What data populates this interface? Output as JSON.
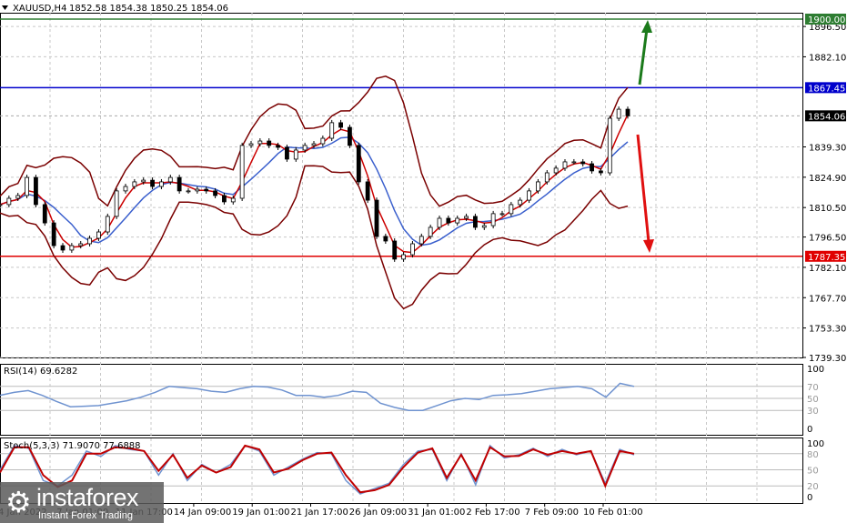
{
  "header": {
    "symbol": "XAUUSD,H4",
    "ohlc": "1852.58 1854.38 1850.25 1854.06"
  },
  "colors": {
    "resistance": "#2e7d32",
    "level_blue": "#0000cc",
    "support": "#e00000",
    "current": "#000000",
    "ma_fast": "#cc0000",
    "ma_slow": "#3a5fcd",
    "bands": "#7a0000",
    "rsi": "#6f93d0",
    "stoch_k": "#6f93d0",
    "stoch_d": "#c00000"
  },
  "levels": [
    {
      "label": "1900.00",
      "value": 1900.0,
      "color": "#2e7d32"
    },
    {
      "label": "1867.45",
      "value": 1867.45,
      "color": "#0000cc"
    },
    {
      "label": "1854.06",
      "value": 1854.06,
      "color": "#000000"
    },
    {
      "label": "1787.35",
      "value": 1787.35,
      "color": "#e00000"
    }
  ],
  "price_ticks": [
    "1896.50",
    "1882.10",
    "1839.30",
    "1824.90",
    "1810.50",
    "1796.50",
    "1782.10",
    "1767.70",
    "1753.30",
    "1739.30"
  ],
  "time_ticks": [
    "4 Jan 2022",
    "7 Jan 01:00",
    "11 Jan 17:00",
    "14 Jan 09:00",
    "19 Jan 01:00",
    "21 Jan 17:00",
    "26 Jan 09:00",
    "31 Jan 01:00",
    "2 Feb 17:00",
    "7 Feb 09:00",
    "10 Feb 01:00"
  ],
  "rsi": {
    "label": "RSI(14) 69.6282",
    "ticks": [
      "100",
      "70",
      "50",
      "30",
      "0"
    ]
  },
  "stoch": {
    "label": "Stoch(5,3,3) 71.9070 77.6888",
    "ticks": [
      "100",
      "80",
      "50",
      "20",
      "0"
    ]
  },
  "logo": {
    "name": "instaforex",
    "tagline": "Instant Forex Trading"
  },
  "chart_data": [
    {
      "type": "line",
      "title": "XAUUSD,H4",
      "ylim": [
        1739.3,
        1900.0
      ],
      "grid": true,
      "closes": [
        1811.9,
        1814.9,
        1816.2,
        1824.8,
        1811.9,
        1803.2,
        1792.4,
        1790.3,
        1792.4,
        1793.3,
        1795.9,
        1798.9,
        1806.3,
        1818.4,
        1820.5,
        1822.7,
        1823.5,
        1820.5,
        1822.7,
        1824.8,
        1818.4,
        1818.4,
        1819.2,
        1818.4,
        1816.2,
        1813.2,
        1814.9,
        1840.0,
        1840.8,
        1842.1,
        1840.0,
        1839.1,
        1833.5,
        1837.8,
        1840.0,
        1840.8,
        1843.4,
        1850.8,
        1848.6,
        1840.0,
        1822.7,
        1814.0,
        1796.8,
        1794.6,
        1786.0,
        1788.1,
        1793.3,
        1796.8,
        1801.1,
        1805.4,
        1803.2,
        1805.4,
        1806.3,
        1801.1,
        1801.9,
        1807.6,
        1807.6,
        1811.9,
        1814.0,
        1818.4,
        1822.7,
        1827.0,
        1829.2,
        1832.2,
        1832.2,
        1831.3,
        1827.9,
        1827.0,
        1852.9,
        1857.2,
        1854.06
      ]
    },
    {
      "type": "line",
      "title": "RSI(14) 69.6282",
      "ylim": [
        0,
        100
      ],
      "values": [
        55,
        60,
        63,
        55,
        45,
        36,
        37,
        38,
        42,
        46,
        52,
        60,
        70,
        68,
        66,
        62,
        60,
        66,
        70,
        69,
        64,
        55,
        55,
        52,
        55,
        62,
        60,
        42,
        35,
        30,
        30,
        38,
        46,
        50,
        48,
        55,
        56,
        58,
        62,
        66,
        68,
        70,
        66,
        52,
        75,
        70
      ]
    },
    {
      "type": "line",
      "title": "Stoch(5,3,3) 71.9070 77.6888",
      "ylim": [
        0,
        100
      ],
      "series": [
        {
          "values": [
            50,
            95,
            90,
            30,
            20,
            40,
            85,
            75,
            95,
            88,
            85,
            40,
            80,
            30,
            60,
            45,
            60,
            95,
            85,
            40,
            55,
            70,
            82,
            80,
            30,
            5,
            15,
            25,
            60,
            85,
            88,
            30,
            80,
            22,
            95,
            72,
            78,
            90,
            75,
            88,
            78,
            85,
            25,
            88,
            78
          ]
        },
        {
          "values": [
            45,
            92,
            92,
            40,
            18,
            30,
            80,
            80,
            92,
            90,
            85,
            48,
            78,
            35,
            58,
            45,
            55,
            95,
            88,
            45,
            52,
            68,
            80,
            82,
            40,
            8,
            12,
            22,
            55,
            82,
            90,
            35,
            78,
            30,
            92,
            75,
            76,
            88,
            78,
            85,
            80,
            85,
            20,
            85,
            80
          ]
        }
      ]
    }
  ]
}
